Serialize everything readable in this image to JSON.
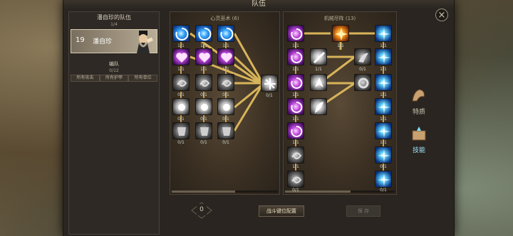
{
  "window": {
    "title": "队伍"
  },
  "team_panel": {
    "title": "潘自珍的队伍",
    "count": "1/4",
    "hero": {
      "level": "19",
      "name": "潘自珍"
    },
    "formation_label": "编队",
    "formation_count": "0/12",
    "filters": [
      "所有攻击",
      "所有护甲",
      "所有单位"
    ]
  },
  "tree_left": {
    "title": "心灵巫术 (6)",
    "ranks": [
      "1/1",
      "1/1",
      "1/1",
      "1/1",
      "1/1",
      "1/1",
      "0/1",
      "0/1",
      "0/1",
      "0/1",
      "0/1",
      "0/1",
      "0/1",
      "0/1",
      "0/1",
      "0/1"
    ]
  },
  "tree_right": {
    "title": "机械尽阵 (13)",
    "ranks": [
      "1/1",
      "1/1",
      "1/1",
      "1/1",
      "1/1",
      "0/1",
      "1/1",
      "1/1",
      "1/1",
      "1/1",
      "1/1",
      "1/1",
      "1/1",
      "1/1",
      "0/1",
      "0/1",
      "0/1",
      "0/1",
      "0/1",
      "0/1"
    ]
  },
  "side_buttons": {
    "traits": "特质",
    "skills": "技能"
  },
  "bottom": {
    "points": "0",
    "config_button": "战斗键位配置",
    "save_button": "保 存"
  },
  "close_icon": "×",
  "colors": {
    "accent": "#e0b458",
    "active": "#9fe6ff"
  }
}
